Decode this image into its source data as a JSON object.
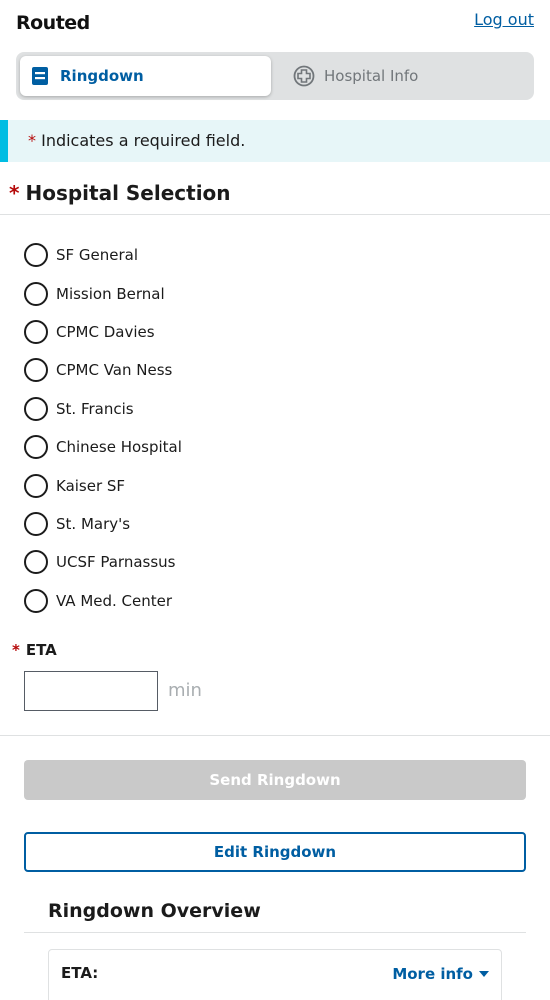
{
  "app": {
    "logo": "Routed",
    "logout_label": "Log out"
  },
  "tabs": [
    {
      "label": "Ringdown",
      "icon": "clipboard-icon",
      "active": true
    },
    {
      "label": "Hospital Info",
      "icon": "hospital-plus-icon",
      "active": false
    }
  ],
  "alert": {
    "asterisk": "*",
    "text": "Indicates a required field."
  },
  "hospital_selection": {
    "asterisk": "*",
    "legend": "Hospital Selection",
    "options": [
      "SF General",
      "Mission Bernal",
      "CPMC Davies",
      "CPMC Van Ness",
      "St. Francis",
      "Chinese Hospital",
      "Kaiser SF",
      "St. Mary's",
      "UCSF Parnassus",
      "VA Med. Center"
    ]
  },
  "eta": {
    "asterisk": "*",
    "label": "ETA",
    "value": "",
    "unit": "min"
  },
  "buttons": {
    "send": "Send Ringdown",
    "edit": "Edit Ringdown"
  },
  "overview": {
    "title": "Ringdown Overview",
    "eta_label": "ETA:",
    "more_info": "More info"
  },
  "colors": {
    "primary": "#005ea2",
    "required": "#b50909",
    "alert_border": "#00bde3",
    "alert_bg": "#e7f6f8",
    "disabled": "#c9c9c9"
  }
}
